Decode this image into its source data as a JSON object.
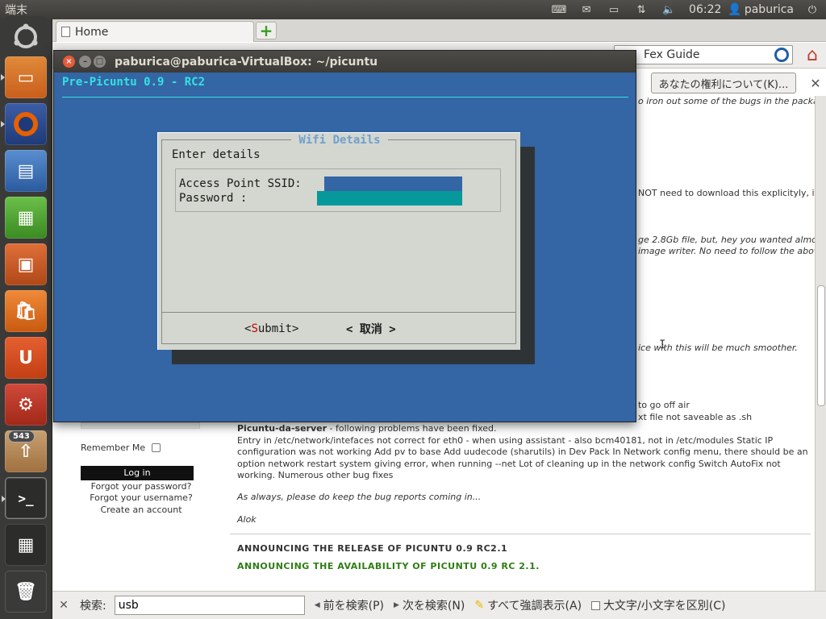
{
  "topbar": {
    "title": "端末",
    "time": "06:22",
    "user": "paburica",
    "icons": [
      "keyboard-icon",
      "mail-icon",
      "battery-icon",
      "network-icon",
      "volume-icon",
      "user-icon",
      "power-icon"
    ]
  },
  "launcher": {
    "items": [
      "dash-home",
      "files",
      "firefox",
      "writer",
      "calc",
      "impress",
      "software-center",
      "ubuntu-one",
      "system-settings",
      "update-manager",
      "terminal",
      "workspace-switcher",
      "trash"
    ],
    "badge": "543"
  },
  "browser": {
    "tab_label": "Home",
    "search_text": "Fex Guide",
    "notification_label": "あなたの権利について(K)...",
    "right_snippets": [
      "o iron out some of the bugs in the package.",
      "NOT need to download this explicityly, if you",
      "ge 2.8Gb file, but, hey you wanted almost",
      "image writer. No need to follow the above two",
      "ice with this will be much smoother.",
      "to go off air",
      "xt file not saveable as .sh"
    ],
    "post": {
      "heading": "Picuntu-da-server",
      "heading_suffix": " - following problems have been fixed.",
      "body": "Entry in /etc/network/intefaces not correct for eth0 - when using assistant - also bcm40181, not in /etc/modules     Static IP configuration was not working    Add pv  to base    Add uudecode (sharutils) in Dev Pack    In Network config menu, there should be an option  network restart    system giving error, when running --net    Lot of cleaning up in the network config    Switch AutoFix not working.    Numerous other bug fixes",
      "closing": "As always, please do keep the bug reports coming in...",
      "signature": "Alok",
      "announce1": "ANNOUNCING THE RELEASE OF PICUNTU 0.9 RC2.1",
      "announce2": "ANNOUNCING THE AVAILABILITY OF PICUNTU 0.9 RC 2.1."
    },
    "sidebar": {
      "remember_me": "Remember Me",
      "login": "Log in",
      "forgot_password": "Forgot your password?",
      "forgot_username": "Forgot your username?",
      "create_account": "Create an account"
    },
    "colors": {
      "announce1": "#333333",
      "announce2": "#2e7d14"
    }
  },
  "findbar": {
    "label": "検索:",
    "value": "usb",
    "prev": "前を検索(P)",
    "next": "次を検索(N)",
    "highlight": "すべて強調表示(A)",
    "match_case": "大文字/小文字を区別(C)"
  },
  "terminal": {
    "title": "paburica@paburica-VirtualBox: ~/picuntu",
    "header": "Pre-Picuntu 0.9 - RC2",
    "dialog": {
      "title": "Wifi Details",
      "prompt": "Enter details",
      "ssid_label": "Access Point SSID:",
      "password_label": "Password :",
      "submit_open": "<",
      "submit_hot": "S",
      "submit_rest": "ubmit>",
      "cancel": "< 取消 >"
    },
    "colors": {
      "background": "#3465a4",
      "header": "#34e2e2",
      "dialog": "#d3d7cf",
      "hotkey": "#cc0000"
    }
  }
}
